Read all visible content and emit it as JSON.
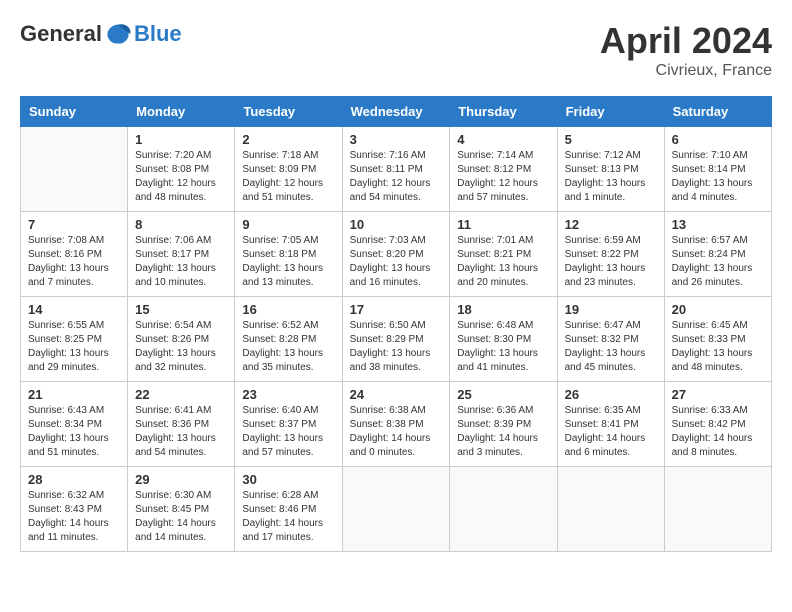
{
  "logo": {
    "general": "General",
    "blue": "Blue"
  },
  "title": "April 2024",
  "location": "Civrieux, France",
  "days_of_week": [
    "Sunday",
    "Monday",
    "Tuesday",
    "Wednesday",
    "Thursday",
    "Friday",
    "Saturday"
  ],
  "weeks": [
    [
      {
        "day": "",
        "sunrise": "",
        "sunset": "",
        "daylight": ""
      },
      {
        "day": "1",
        "sunrise": "Sunrise: 7:20 AM",
        "sunset": "Sunset: 8:08 PM",
        "daylight": "Daylight: 12 hours and 48 minutes."
      },
      {
        "day": "2",
        "sunrise": "Sunrise: 7:18 AM",
        "sunset": "Sunset: 8:09 PM",
        "daylight": "Daylight: 12 hours and 51 minutes."
      },
      {
        "day": "3",
        "sunrise": "Sunrise: 7:16 AM",
        "sunset": "Sunset: 8:11 PM",
        "daylight": "Daylight: 12 hours and 54 minutes."
      },
      {
        "day": "4",
        "sunrise": "Sunrise: 7:14 AM",
        "sunset": "Sunset: 8:12 PM",
        "daylight": "Daylight: 12 hours and 57 minutes."
      },
      {
        "day": "5",
        "sunrise": "Sunrise: 7:12 AM",
        "sunset": "Sunset: 8:13 PM",
        "daylight": "Daylight: 13 hours and 1 minute."
      },
      {
        "day": "6",
        "sunrise": "Sunrise: 7:10 AM",
        "sunset": "Sunset: 8:14 PM",
        "daylight": "Daylight: 13 hours and 4 minutes."
      }
    ],
    [
      {
        "day": "7",
        "sunrise": "Sunrise: 7:08 AM",
        "sunset": "Sunset: 8:16 PM",
        "daylight": "Daylight: 13 hours and 7 minutes."
      },
      {
        "day": "8",
        "sunrise": "Sunrise: 7:06 AM",
        "sunset": "Sunset: 8:17 PM",
        "daylight": "Daylight: 13 hours and 10 minutes."
      },
      {
        "day": "9",
        "sunrise": "Sunrise: 7:05 AM",
        "sunset": "Sunset: 8:18 PM",
        "daylight": "Daylight: 13 hours and 13 minutes."
      },
      {
        "day": "10",
        "sunrise": "Sunrise: 7:03 AM",
        "sunset": "Sunset: 8:20 PM",
        "daylight": "Daylight: 13 hours and 16 minutes."
      },
      {
        "day": "11",
        "sunrise": "Sunrise: 7:01 AM",
        "sunset": "Sunset: 8:21 PM",
        "daylight": "Daylight: 13 hours and 20 minutes."
      },
      {
        "day": "12",
        "sunrise": "Sunrise: 6:59 AM",
        "sunset": "Sunset: 8:22 PM",
        "daylight": "Daylight: 13 hours and 23 minutes."
      },
      {
        "day": "13",
        "sunrise": "Sunrise: 6:57 AM",
        "sunset": "Sunset: 8:24 PM",
        "daylight": "Daylight: 13 hours and 26 minutes."
      }
    ],
    [
      {
        "day": "14",
        "sunrise": "Sunrise: 6:55 AM",
        "sunset": "Sunset: 8:25 PM",
        "daylight": "Daylight: 13 hours and 29 minutes."
      },
      {
        "day": "15",
        "sunrise": "Sunrise: 6:54 AM",
        "sunset": "Sunset: 8:26 PM",
        "daylight": "Daylight: 13 hours and 32 minutes."
      },
      {
        "day": "16",
        "sunrise": "Sunrise: 6:52 AM",
        "sunset": "Sunset: 8:28 PM",
        "daylight": "Daylight: 13 hours and 35 minutes."
      },
      {
        "day": "17",
        "sunrise": "Sunrise: 6:50 AM",
        "sunset": "Sunset: 8:29 PM",
        "daylight": "Daylight: 13 hours and 38 minutes."
      },
      {
        "day": "18",
        "sunrise": "Sunrise: 6:48 AM",
        "sunset": "Sunset: 8:30 PM",
        "daylight": "Daylight: 13 hours and 41 minutes."
      },
      {
        "day": "19",
        "sunrise": "Sunrise: 6:47 AM",
        "sunset": "Sunset: 8:32 PM",
        "daylight": "Daylight: 13 hours and 45 minutes."
      },
      {
        "day": "20",
        "sunrise": "Sunrise: 6:45 AM",
        "sunset": "Sunset: 8:33 PM",
        "daylight": "Daylight: 13 hours and 48 minutes."
      }
    ],
    [
      {
        "day": "21",
        "sunrise": "Sunrise: 6:43 AM",
        "sunset": "Sunset: 8:34 PM",
        "daylight": "Daylight: 13 hours and 51 minutes."
      },
      {
        "day": "22",
        "sunrise": "Sunrise: 6:41 AM",
        "sunset": "Sunset: 8:36 PM",
        "daylight": "Daylight: 13 hours and 54 minutes."
      },
      {
        "day": "23",
        "sunrise": "Sunrise: 6:40 AM",
        "sunset": "Sunset: 8:37 PM",
        "daylight": "Daylight: 13 hours and 57 minutes."
      },
      {
        "day": "24",
        "sunrise": "Sunrise: 6:38 AM",
        "sunset": "Sunset: 8:38 PM",
        "daylight": "Daylight: 14 hours and 0 minutes."
      },
      {
        "day": "25",
        "sunrise": "Sunrise: 6:36 AM",
        "sunset": "Sunset: 8:39 PM",
        "daylight": "Daylight: 14 hours and 3 minutes."
      },
      {
        "day": "26",
        "sunrise": "Sunrise: 6:35 AM",
        "sunset": "Sunset: 8:41 PM",
        "daylight": "Daylight: 14 hours and 6 minutes."
      },
      {
        "day": "27",
        "sunrise": "Sunrise: 6:33 AM",
        "sunset": "Sunset: 8:42 PM",
        "daylight": "Daylight: 14 hours and 8 minutes."
      }
    ],
    [
      {
        "day": "28",
        "sunrise": "Sunrise: 6:32 AM",
        "sunset": "Sunset: 8:43 PM",
        "daylight": "Daylight: 14 hours and 11 minutes."
      },
      {
        "day": "29",
        "sunrise": "Sunrise: 6:30 AM",
        "sunset": "Sunset: 8:45 PM",
        "daylight": "Daylight: 14 hours and 14 minutes."
      },
      {
        "day": "30",
        "sunrise": "Sunrise: 6:28 AM",
        "sunset": "Sunset: 8:46 PM",
        "daylight": "Daylight: 14 hours and 17 minutes."
      },
      {
        "day": "",
        "sunrise": "",
        "sunset": "",
        "daylight": ""
      },
      {
        "day": "",
        "sunrise": "",
        "sunset": "",
        "daylight": ""
      },
      {
        "day": "",
        "sunrise": "",
        "sunset": "",
        "daylight": ""
      },
      {
        "day": "",
        "sunrise": "",
        "sunset": "",
        "daylight": ""
      }
    ]
  ]
}
